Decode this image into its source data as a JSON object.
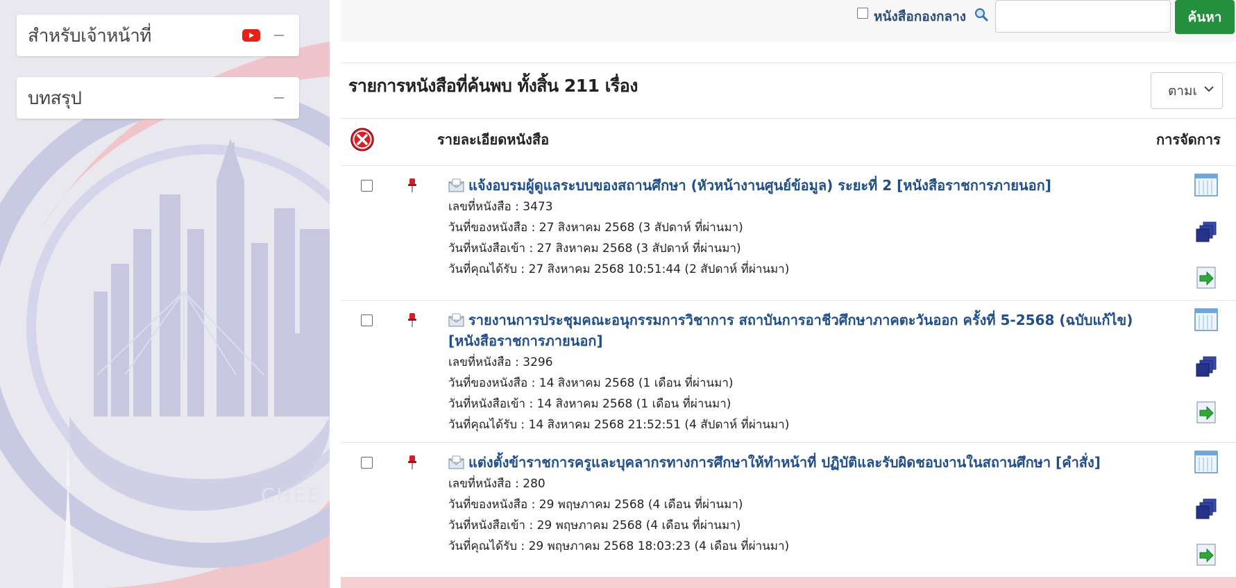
{
  "sidebar": {
    "panels": [
      {
        "title": "สำหรับเจ้าหน้าที่",
        "icons": [
          "youtube-icon",
          "minus-icon"
        ]
      },
      {
        "title": "บทสรุป",
        "icons": [
          "minus-icon"
        ]
      }
    ],
    "watermark_text": "CHEE"
  },
  "search": {
    "central_label": "หนังสือกองกลาง",
    "input_value": "",
    "button_label": "ค้นหา"
  },
  "results": {
    "title": "รายการหนังสือที่ค้นพบ ทั้งสิ้น 211 เรื่อง",
    "sort_value": "ตามเ"
  },
  "table": {
    "col_detail": "รายละเอียดหนังสือ",
    "col_manage": "การจัดการ"
  },
  "documents": [
    {
      "title": "แจ้งอบรมผู้ดูแลระบบของสถานศึกษา (หัวหน้างานศูนย์ข้อมูล) ระยะที่ 2 [หนังสือราชการภายนอก]",
      "number": "เลขที่หนังสือ : 3473",
      "doc_date": "วันที่ของหนังสือ : 27 สิงหาคม 2568 (3 สัปดาห์ ที่ผ่านมา)",
      "in_date": "วันที่หนังสือเข้า : 27 สิงหาคม 2568 (3 สัปดาห์ ที่ผ่านมา)",
      "recv_date": "วันที่คุณได้รับ : 27 สิงหาคม 2568 10:51:44 (2 สัปดาห์ ที่ผ่านมา)"
    },
    {
      "title": "รายงานการประชุมคณะอนุกรรมการวิชาการ สถาบันการอาชีวศึกษาภาคตะวันออก ครั้งที่ 5-2568 (ฉบับแก้ไข) [หนังสือราชการภายนอก]",
      "number": "เลขที่หนังสือ : 3296",
      "doc_date": "วันที่ของหนังสือ : 14 สิงหาคม 2568 (1 เดือน ที่ผ่านมา)",
      "in_date": "วันที่หนังสือเข้า : 14 สิงหาคม 2568 (1 เดือน ที่ผ่านมา)",
      "recv_date": "วันที่คุณได้รับ : 14 สิงหาคม 2568 21:52:51 (4 สัปดาห์ ที่ผ่านมา)"
    },
    {
      "title": "แต่งตั้งข้าราชการครูและบุคลากรทางการศึกษาให้ทำหน้าที่ ปฏิบัติและรับผิดชอบงานในสถานศึกษา [คำสั่ง]",
      "number": "เลขที่หนังสือ : 280",
      "doc_date": "วันที่ของหนังสือ : 29 พฤษภาคม 2568 (4 เดือน ที่ผ่านมา)",
      "in_date": "วันที่หนังสือเข้า : 29 พฤษภาคม 2568 (4 เดือน ที่ผ่านมา)",
      "recv_date": "วันที่คุณได้รับ : 29 พฤษภาคม 2568 18:03:23 (4 เดือน ที่ผ่านมา)"
    }
  ],
  "colors": {
    "link": "#1f4e8a",
    "search_button": "#23903d",
    "youtube": "#e62117",
    "highlight_row": "#f6cfd1"
  }
}
